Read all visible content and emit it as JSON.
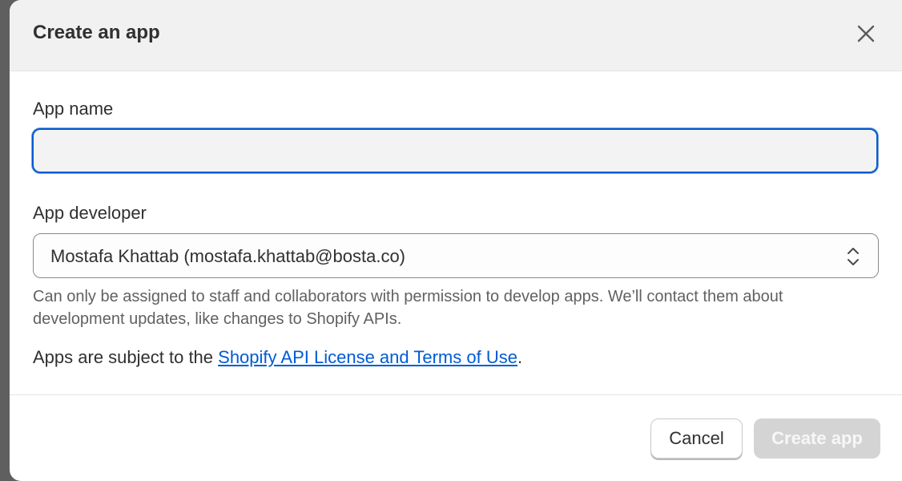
{
  "modal": {
    "title": "Create an app",
    "close_icon": "close-icon"
  },
  "form": {
    "app_name_label": "App name",
    "app_name_value": "",
    "app_developer_label": "App developer",
    "app_developer_selected": "Mostafa Khattab (mostafa.khattab@bosta.co)",
    "select_icon": "chevron-up-down-icon",
    "help_text": "Can only be assigned to staff and collaborators with permission to develop apps. We’ll contact them about development updates, like changes to Shopify APIs.",
    "terms_prefix": "Apps are subject to the ",
    "terms_link": "Shopify API License and Terms of Use",
    "terms_suffix": "."
  },
  "footer": {
    "cancel_label": "Cancel",
    "create_label": "Create app"
  },
  "colors": {
    "link": "#005bd3",
    "focus_border": "#005bd3",
    "disabled_button": "#d4d4d4"
  }
}
